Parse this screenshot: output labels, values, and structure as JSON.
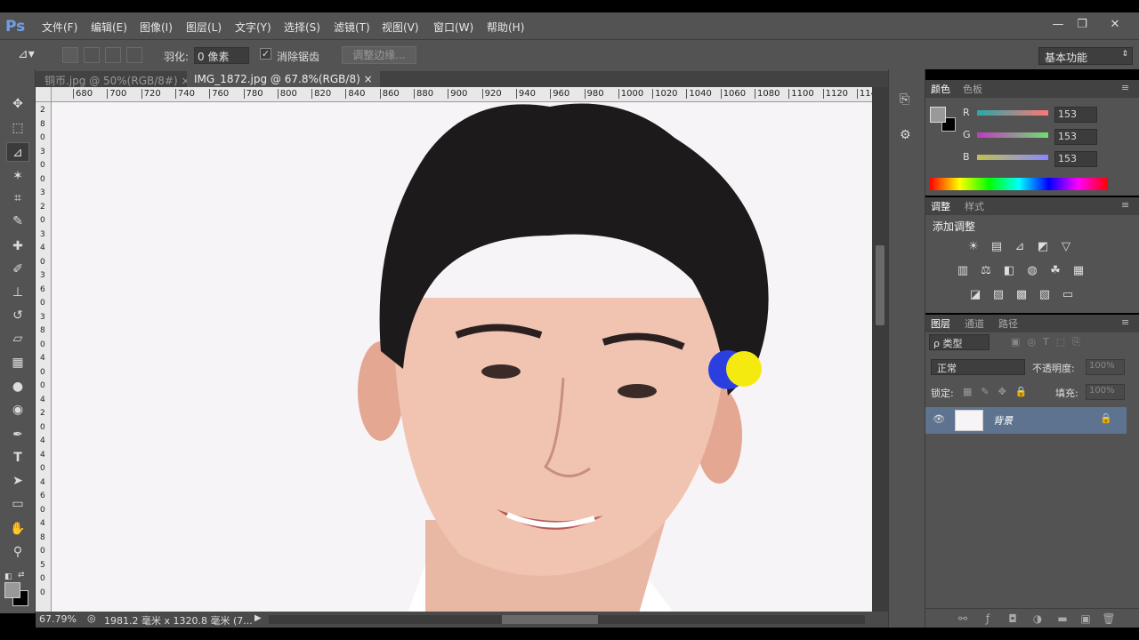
{
  "app": {
    "logo": "Ps"
  },
  "menu": [
    "文件(F)",
    "编辑(E)",
    "图像(I)",
    "图层(L)",
    "文字(Y)",
    "选择(S)",
    "滤镜(T)",
    "视图(V)",
    "窗口(W)",
    "帮助(H)"
  ],
  "window_controls": {
    "minimize": "—",
    "restore": "❐",
    "close": "✕"
  },
  "options": {
    "feather_label": "羽化:",
    "feather_value": "0 像素",
    "antialias_label": "消除锯齿",
    "refine_label": "调整边缘...",
    "workspace": "基本功能"
  },
  "tabs": [
    {
      "label": "铜币.jpg @ 50%(RGB/8#)",
      "close": "×"
    },
    {
      "label": "IMG_1872.jpg @ 67.8%(RGB/8)",
      "close": "×"
    }
  ],
  "ruler_h": [
    "680",
    "700",
    "720",
    "740",
    "760",
    "780",
    "800",
    "820",
    "840",
    "860",
    "880",
    "900",
    "920",
    "940",
    "960",
    "980",
    "1000",
    "1020",
    "1040",
    "1060",
    "1080",
    "1100",
    "1120",
    "114"
  ],
  "ruler_v": [
    "2",
    "8",
    "0",
    "3",
    "0",
    "0",
    "3",
    "2",
    "0",
    "3",
    "4",
    "0",
    "3",
    "6",
    "0",
    "3",
    "8",
    "0",
    "4",
    "0",
    "0",
    "4",
    "2",
    "0",
    "4",
    "4",
    "0",
    "4",
    "6",
    "0",
    "4",
    "8",
    "0",
    "5",
    "0",
    "0"
  ],
  "status": {
    "zoom": "67.79%",
    "doc_info": "1981.2 毫米 x 1320.8 毫米 (7..."
  },
  "color_panel": {
    "tabs": [
      "颜色",
      "色板"
    ],
    "channels": [
      {
        "label": "R",
        "value": "153"
      },
      {
        "label": "G",
        "value": "153"
      },
      {
        "label": "B",
        "value": "153"
      }
    ],
    "foreground": "#999999",
    "background": "#000000"
  },
  "adjust_panel": {
    "tabs": [
      "调整",
      "样式"
    ],
    "title": "添加调整"
  },
  "layers_panel": {
    "tabs": [
      "图层",
      "通道",
      "路径"
    ],
    "filter_label": "ρ 类型",
    "blend_mode": "正常",
    "opacity_label": "不透明度:",
    "opacity_value": "100%",
    "lock_label": "锁定:",
    "fill_label": "填充:",
    "fill_value": "100%",
    "layers": [
      {
        "name": "背景"
      }
    ]
  }
}
